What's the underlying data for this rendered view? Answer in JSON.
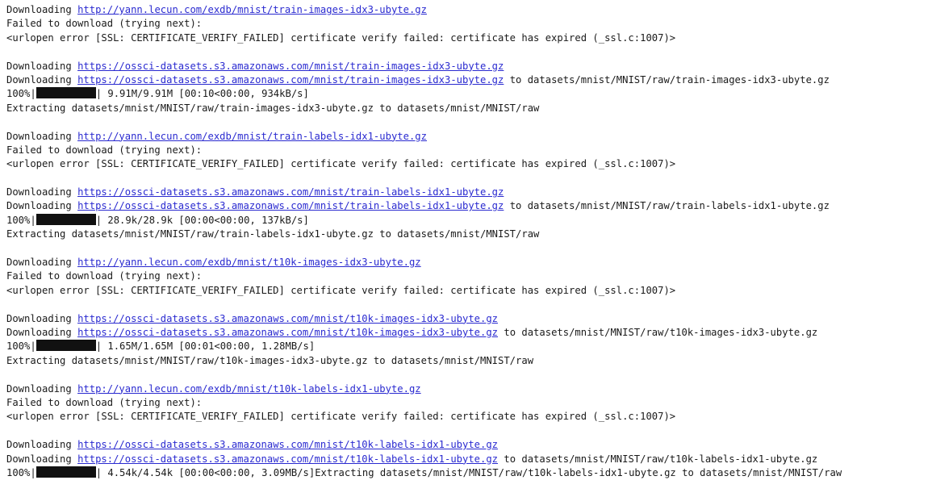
{
  "log": [
    {
      "type": "dl",
      "prefix": "Downloading ",
      "url": "http://yann.lecun.com/exdb/mnist/train-images-idx3-ubyte.gz",
      "suffix": ""
    },
    {
      "type": "text",
      "text": "Failed to download (trying next):"
    },
    {
      "type": "text",
      "text": "<urlopen error [SSL: CERTIFICATE_VERIFY_FAILED] certificate verify failed: certificate has expired (_ssl.c:1007)>"
    },
    {
      "type": "blank"
    },
    {
      "type": "dl",
      "prefix": "Downloading ",
      "url": "https://ossci-datasets.s3.amazonaws.com/mnist/train-images-idx3-ubyte.gz",
      "suffix": ""
    },
    {
      "type": "dl",
      "prefix": "Downloading ",
      "url": "https://ossci-datasets.s3.amazonaws.com/mnist/train-images-idx3-ubyte.gz",
      "suffix": " to datasets/mnist/MNIST/raw/train-images-idx3-ubyte.gz"
    },
    {
      "type": "progress",
      "percent": "100%|",
      "fraction": 1.0,
      "stats": "| 9.91M/9.91M [00:10<00:00, 934kB/s]",
      "after": ""
    },
    {
      "type": "text",
      "text": "Extracting datasets/mnist/MNIST/raw/train-images-idx3-ubyte.gz to datasets/mnist/MNIST/raw"
    },
    {
      "type": "blank"
    },
    {
      "type": "dl",
      "prefix": "Downloading ",
      "url": "http://yann.lecun.com/exdb/mnist/train-labels-idx1-ubyte.gz",
      "suffix": ""
    },
    {
      "type": "text",
      "text": "Failed to download (trying next):"
    },
    {
      "type": "text",
      "text": "<urlopen error [SSL: CERTIFICATE_VERIFY_FAILED] certificate verify failed: certificate has expired (_ssl.c:1007)>"
    },
    {
      "type": "blank"
    },
    {
      "type": "dl",
      "prefix": "Downloading ",
      "url": "https://ossci-datasets.s3.amazonaws.com/mnist/train-labels-idx1-ubyte.gz",
      "suffix": ""
    },
    {
      "type": "dl",
      "prefix": "Downloading ",
      "url": "https://ossci-datasets.s3.amazonaws.com/mnist/train-labels-idx1-ubyte.gz",
      "suffix": " to datasets/mnist/MNIST/raw/train-labels-idx1-ubyte.gz"
    },
    {
      "type": "progress",
      "percent": "100%|",
      "fraction": 1.0,
      "stats": "| 28.9k/28.9k [00:00<00:00, 137kB/s]",
      "after": ""
    },
    {
      "type": "text",
      "text": "Extracting datasets/mnist/MNIST/raw/train-labels-idx1-ubyte.gz to datasets/mnist/MNIST/raw"
    },
    {
      "type": "blank"
    },
    {
      "type": "dl",
      "prefix": "Downloading ",
      "url": "http://yann.lecun.com/exdb/mnist/t10k-images-idx3-ubyte.gz",
      "suffix": ""
    },
    {
      "type": "text",
      "text": "Failed to download (trying next):"
    },
    {
      "type": "text",
      "text": "<urlopen error [SSL: CERTIFICATE_VERIFY_FAILED] certificate verify failed: certificate has expired (_ssl.c:1007)>"
    },
    {
      "type": "blank"
    },
    {
      "type": "dl",
      "prefix": "Downloading ",
      "url": "https://ossci-datasets.s3.amazonaws.com/mnist/t10k-images-idx3-ubyte.gz",
      "suffix": ""
    },
    {
      "type": "dl",
      "prefix": "Downloading ",
      "url": "https://ossci-datasets.s3.amazonaws.com/mnist/t10k-images-idx3-ubyte.gz",
      "suffix": " to datasets/mnist/MNIST/raw/t10k-images-idx3-ubyte.gz"
    },
    {
      "type": "progress",
      "percent": "100%|",
      "fraction": 1.0,
      "stats": "| 1.65M/1.65M [00:01<00:00, 1.28MB/s]",
      "after": ""
    },
    {
      "type": "text",
      "text": "Extracting datasets/mnist/MNIST/raw/t10k-images-idx3-ubyte.gz to datasets/mnist/MNIST/raw"
    },
    {
      "type": "blank"
    },
    {
      "type": "dl",
      "prefix": "Downloading ",
      "url": "http://yann.lecun.com/exdb/mnist/t10k-labels-idx1-ubyte.gz",
      "suffix": ""
    },
    {
      "type": "text",
      "text": "Failed to download (trying next):"
    },
    {
      "type": "text",
      "text": "<urlopen error [SSL: CERTIFICATE_VERIFY_FAILED] certificate verify failed: certificate has expired (_ssl.c:1007)>"
    },
    {
      "type": "blank"
    },
    {
      "type": "dl",
      "prefix": "Downloading ",
      "url": "https://ossci-datasets.s3.amazonaws.com/mnist/t10k-labels-idx1-ubyte.gz",
      "suffix": ""
    },
    {
      "type": "dl",
      "prefix": "Downloading ",
      "url": "https://ossci-datasets.s3.amazonaws.com/mnist/t10k-labels-idx1-ubyte.gz",
      "suffix": " to datasets/mnist/MNIST/raw/t10k-labels-idx1-ubyte.gz"
    },
    {
      "type": "progress",
      "percent": "100%|",
      "fraction": 1.0,
      "stats": "| 4.54k/4.54k [00:00<00:00, 3.09MB/s]",
      "after": "Extracting datasets/mnist/MNIST/raw/t10k-labels-idx1-ubyte.gz to datasets/mnist/MNIST/raw"
    }
  ],
  "colors": {
    "text": "#1a1a1a",
    "link": "#2a2ad0",
    "progress_bar": "#111111",
    "background": "#ffffff"
  }
}
